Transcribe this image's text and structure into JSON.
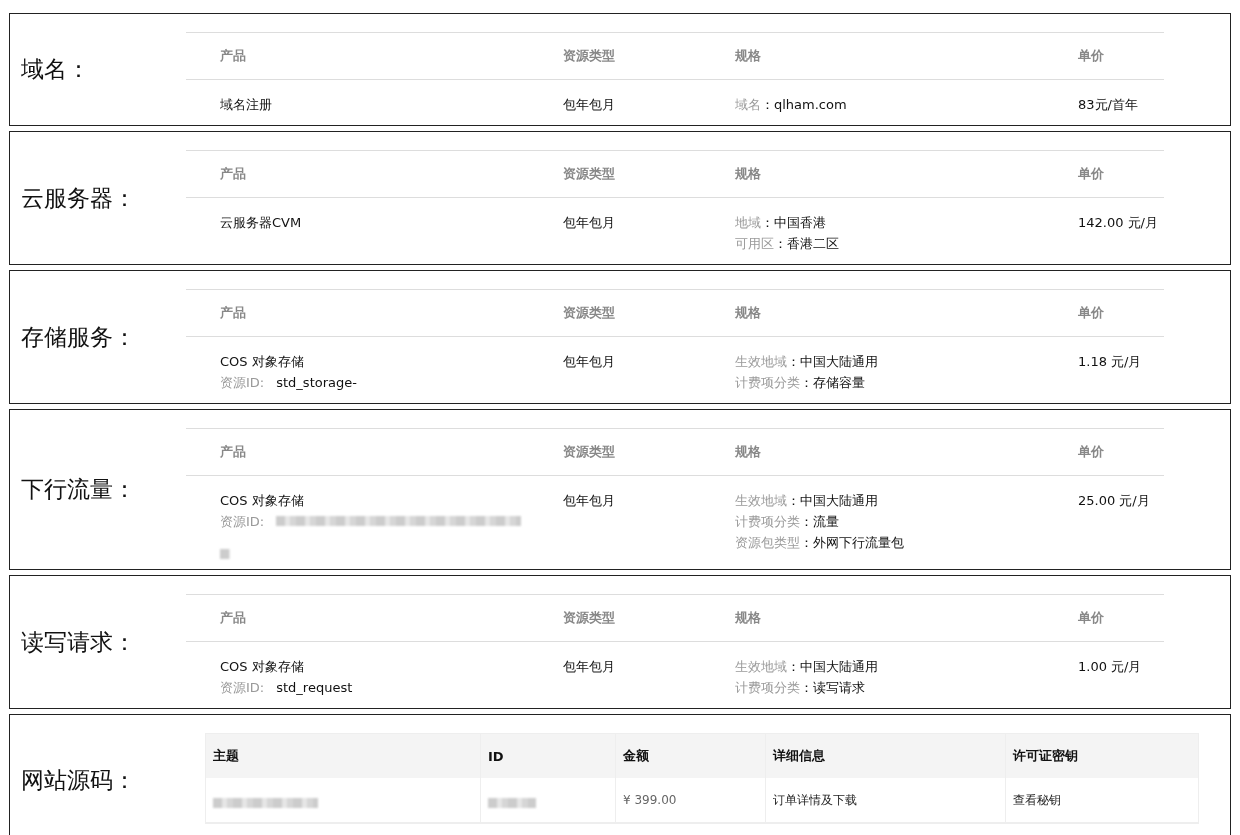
{
  "sections": [
    {
      "label": "域名：",
      "kind": "spec_table",
      "columns": [
        "产品",
        "资源类型",
        "规格",
        "单价"
      ],
      "rows": [
        {
          "product": "域名注册",
          "product_sub": [],
          "resource_type": "包年包月",
          "specs": [
            {
              "key": "域名",
              "value": "：qlham.com"
            }
          ],
          "price": "83元/首年"
        }
      ]
    },
    {
      "label": "云服务器：",
      "kind": "spec_table",
      "columns": [
        "产品",
        "资源类型",
        "规格",
        "单价"
      ],
      "rows": [
        {
          "product": "云服务器CVM",
          "product_sub": [],
          "resource_type": "包年包月",
          "specs": [
            {
              "key": "地域",
              "value": "：中国香港"
            },
            {
              "key": "可用区",
              "value": "：香港二区"
            }
          ],
          "price": "142.00 元/月"
        }
      ]
    },
    {
      "label": "存储服务：",
      "kind": "spec_table",
      "columns": [
        "产品",
        "资源类型",
        "规格",
        "单价"
      ],
      "rows": [
        {
          "product": "COS 对象存储",
          "product_sub": [
            {
              "key": "资源ID:",
              "value": "std_storage-",
              "redacted": false
            }
          ],
          "resource_type": "包年包月",
          "specs": [
            {
              "key": "生效地域",
              "value": "：中国大陆通用"
            },
            {
              "key": "计费项分类",
              "value": "：存储容量"
            }
          ],
          "price": "1.18 元/月"
        }
      ]
    },
    {
      "label": "下行流量：",
      "kind": "spec_table",
      "columns": [
        "产品",
        "资源类型",
        "规格",
        "单价"
      ],
      "rows": [
        {
          "product": "COS 对象存储",
          "product_sub": [
            {
              "key": "资源ID:",
              "redacted": true
            }
          ],
          "resource_type": "包年包月",
          "specs": [
            {
              "key": "生效地域",
              "value": "：中国大陆通用"
            },
            {
              "key": "计费项分类",
              "value": "：流量"
            },
            {
              "key": "资源包类型",
              "value": "：外网下行流量包"
            }
          ],
          "price": "25.00 元/月"
        }
      ]
    },
    {
      "label": "读写请求：",
      "kind": "spec_table",
      "columns": [
        "产品",
        "资源类型",
        "规格",
        "单价"
      ],
      "rows": [
        {
          "product": "COS 对象存储",
          "product_sub": [
            {
              "key": "资源ID:",
              "value": "std_request",
              "redacted": false
            }
          ],
          "resource_type": "包年包月",
          "specs": [
            {
              "key": "生效地域",
              "value": "：中国大陆通用"
            },
            {
              "key": "计费项分类",
              "value": "：读写请求"
            }
          ],
          "price": "1.00 元/月"
        }
      ]
    },
    {
      "label": "网站源码：",
      "kind": "order_table",
      "columns": [
        "主题",
        "ID",
        "金额",
        "详细信息",
        "许可证密钥"
      ],
      "rows": [
        {
          "cells": [
            {
              "kind": "redacted"
            },
            {
              "kind": "redacted"
            },
            {
              "kind": "text",
              "text": "¥ 399.00"
            },
            {
              "kind": "link",
              "text": "订单详情及下载"
            },
            {
              "kind": "link",
              "text": "查看秘钥"
            }
          ]
        }
      ]
    }
  ]
}
